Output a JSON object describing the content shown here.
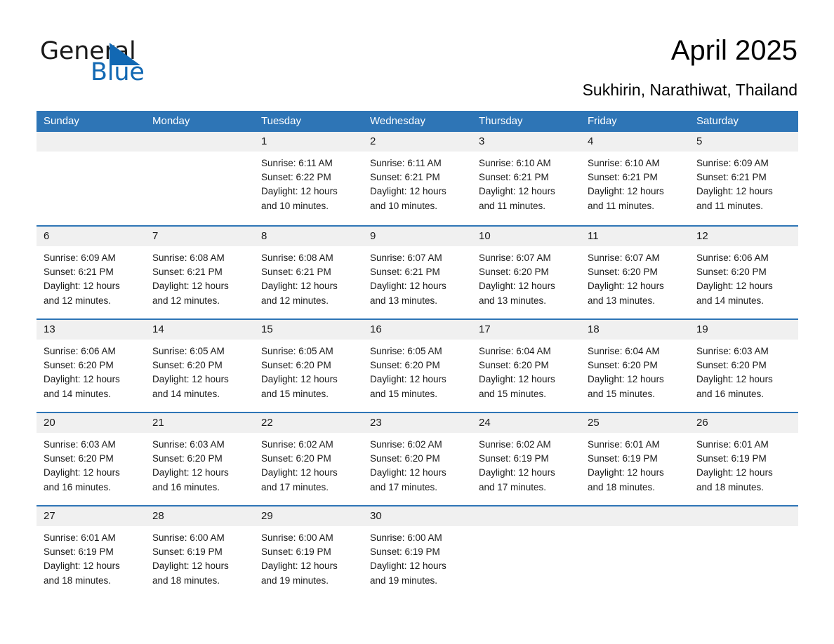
{
  "brand": {
    "name_part1": "General",
    "name_part2": "Blue",
    "accent_color": "#1268b3"
  },
  "header": {
    "title": "April 2025",
    "subtitle": "Sukhirin, Narathiwat, Thailand"
  },
  "calendar": {
    "header_bg": "#2e75b6",
    "daynum_bg": "#f0f0f0",
    "weekday_headers": [
      "Sunday",
      "Monday",
      "Tuesday",
      "Wednesday",
      "Thursday",
      "Friday",
      "Saturday"
    ],
    "weeks": [
      [
        {
          "day": "",
          "sunrise": "",
          "sunset": "",
          "daylight": "",
          "empty": true
        },
        {
          "day": "",
          "sunrise": "",
          "sunset": "",
          "daylight": "",
          "empty": true
        },
        {
          "day": "1",
          "sunrise": "Sunrise: 6:11 AM",
          "sunset": "Sunset: 6:22 PM",
          "daylight": "Daylight: 12 hours and 10 minutes."
        },
        {
          "day": "2",
          "sunrise": "Sunrise: 6:11 AM",
          "sunset": "Sunset: 6:21 PM",
          "daylight": "Daylight: 12 hours and 10 minutes."
        },
        {
          "day": "3",
          "sunrise": "Sunrise: 6:10 AM",
          "sunset": "Sunset: 6:21 PM",
          "daylight": "Daylight: 12 hours and 11 minutes."
        },
        {
          "day": "4",
          "sunrise": "Sunrise: 6:10 AM",
          "sunset": "Sunset: 6:21 PM",
          "daylight": "Daylight: 12 hours and 11 minutes."
        },
        {
          "day": "5",
          "sunrise": "Sunrise: 6:09 AM",
          "sunset": "Sunset: 6:21 PM",
          "daylight": "Daylight: 12 hours and 11 minutes."
        }
      ],
      [
        {
          "day": "6",
          "sunrise": "Sunrise: 6:09 AM",
          "sunset": "Sunset: 6:21 PM",
          "daylight": "Daylight: 12 hours and 12 minutes."
        },
        {
          "day": "7",
          "sunrise": "Sunrise: 6:08 AM",
          "sunset": "Sunset: 6:21 PM",
          "daylight": "Daylight: 12 hours and 12 minutes."
        },
        {
          "day": "8",
          "sunrise": "Sunrise: 6:08 AM",
          "sunset": "Sunset: 6:21 PM",
          "daylight": "Daylight: 12 hours and 12 minutes."
        },
        {
          "day": "9",
          "sunrise": "Sunrise: 6:07 AM",
          "sunset": "Sunset: 6:21 PM",
          "daylight": "Daylight: 12 hours and 13 minutes."
        },
        {
          "day": "10",
          "sunrise": "Sunrise: 6:07 AM",
          "sunset": "Sunset: 6:20 PM",
          "daylight": "Daylight: 12 hours and 13 minutes."
        },
        {
          "day": "11",
          "sunrise": "Sunrise: 6:07 AM",
          "sunset": "Sunset: 6:20 PM",
          "daylight": "Daylight: 12 hours and 13 minutes."
        },
        {
          "day": "12",
          "sunrise": "Sunrise: 6:06 AM",
          "sunset": "Sunset: 6:20 PM",
          "daylight": "Daylight: 12 hours and 14 minutes."
        }
      ],
      [
        {
          "day": "13",
          "sunrise": "Sunrise: 6:06 AM",
          "sunset": "Sunset: 6:20 PM",
          "daylight": "Daylight: 12 hours and 14 minutes."
        },
        {
          "day": "14",
          "sunrise": "Sunrise: 6:05 AM",
          "sunset": "Sunset: 6:20 PM",
          "daylight": "Daylight: 12 hours and 14 minutes."
        },
        {
          "day": "15",
          "sunrise": "Sunrise: 6:05 AM",
          "sunset": "Sunset: 6:20 PM",
          "daylight": "Daylight: 12 hours and 15 minutes."
        },
        {
          "day": "16",
          "sunrise": "Sunrise: 6:05 AM",
          "sunset": "Sunset: 6:20 PM",
          "daylight": "Daylight: 12 hours and 15 minutes."
        },
        {
          "day": "17",
          "sunrise": "Sunrise: 6:04 AM",
          "sunset": "Sunset: 6:20 PM",
          "daylight": "Daylight: 12 hours and 15 minutes."
        },
        {
          "day": "18",
          "sunrise": "Sunrise: 6:04 AM",
          "sunset": "Sunset: 6:20 PM",
          "daylight": "Daylight: 12 hours and 15 minutes."
        },
        {
          "day": "19",
          "sunrise": "Sunrise: 6:03 AM",
          "sunset": "Sunset: 6:20 PM",
          "daylight": "Daylight: 12 hours and 16 minutes."
        }
      ],
      [
        {
          "day": "20",
          "sunrise": "Sunrise: 6:03 AM",
          "sunset": "Sunset: 6:20 PM",
          "daylight": "Daylight: 12 hours and 16 minutes."
        },
        {
          "day": "21",
          "sunrise": "Sunrise: 6:03 AM",
          "sunset": "Sunset: 6:20 PM",
          "daylight": "Daylight: 12 hours and 16 minutes."
        },
        {
          "day": "22",
          "sunrise": "Sunrise: 6:02 AM",
          "sunset": "Sunset: 6:20 PM",
          "daylight": "Daylight: 12 hours and 17 minutes."
        },
        {
          "day": "23",
          "sunrise": "Sunrise: 6:02 AM",
          "sunset": "Sunset: 6:20 PM",
          "daylight": "Daylight: 12 hours and 17 minutes."
        },
        {
          "day": "24",
          "sunrise": "Sunrise: 6:02 AM",
          "sunset": "Sunset: 6:19 PM",
          "daylight": "Daylight: 12 hours and 17 minutes."
        },
        {
          "day": "25",
          "sunrise": "Sunrise: 6:01 AM",
          "sunset": "Sunset: 6:19 PM",
          "daylight": "Daylight: 12 hours and 18 minutes."
        },
        {
          "day": "26",
          "sunrise": "Sunrise: 6:01 AM",
          "sunset": "Sunset: 6:19 PM",
          "daylight": "Daylight: 12 hours and 18 minutes."
        }
      ],
      [
        {
          "day": "27",
          "sunrise": "Sunrise: 6:01 AM",
          "sunset": "Sunset: 6:19 PM",
          "daylight": "Daylight: 12 hours and 18 minutes."
        },
        {
          "day": "28",
          "sunrise": "Sunrise: 6:00 AM",
          "sunset": "Sunset: 6:19 PM",
          "daylight": "Daylight: 12 hours and 18 minutes."
        },
        {
          "day": "29",
          "sunrise": "Sunrise: 6:00 AM",
          "sunset": "Sunset: 6:19 PM",
          "daylight": "Daylight: 12 hours and 19 minutes."
        },
        {
          "day": "30",
          "sunrise": "Sunrise: 6:00 AM",
          "sunset": "Sunset: 6:19 PM",
          "daylight": "Daylight: 12 hours and 19 minutes."
        },
        {
          "day": "",
          "sunrise": "",
          "sunset": "",
          "daylight": "",
          "empty": true
        },
        {
          "day": "",
          "sunrise": "",
          "sunset": "",
          "daylight": "",
          "empty": true
        },
        {
          "day": "",
          "sunrise": "",
          "sunset": "",
          "daylight": "",
          "empty": true
        }
      ]
    ]
  }
}
